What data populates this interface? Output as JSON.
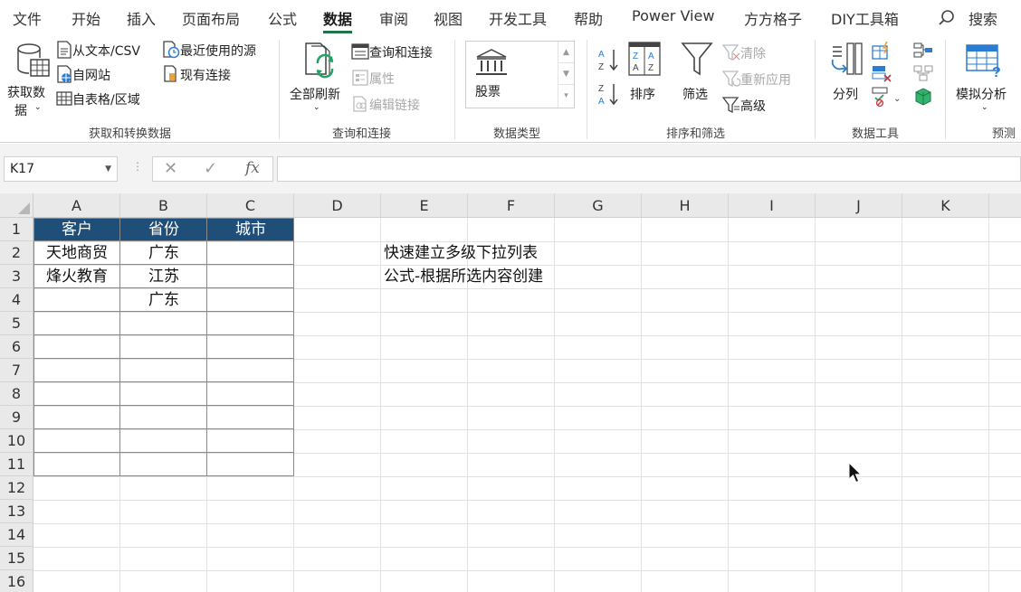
{
  "tabs": [
    {
      "label": "文件"
    },
    {
      "label": "开始"
    },
    {
      "label": "插入"
    },
    {
      "label": "页面布局"
    },
    {
      "label": "公式"
    },
    {
      "label": "数据"
    },
    {
      "label": "审阅"
    },
    {
      "label": "视图"
    },
    {
      "label": "开发工具"
    },
    {
      "label": "帮助"
    },
    {
      "label": "Power View"
    },
    {
      "label": "方方格子"
    },
    {
      "label": "DIY工具箱"
    }
  ],
  "active_tab": "数据",
  "search_label": "搜索",
  "ribbon": {
    "get_data": {
      "big_label_1": "获取数",
      "big_label_2": "据",
      "from_text": "从文本/CSV",
      "from_web": "自网站",
      "from_table": "自表格/区域",
      "recent_sources": "最近使用的源",
      "existing_connections": "现有连接",
      "group_label": "获取和转换数据"
    },
    "queries": {
      "refresh_all": "全部刷新",
      "queries_connections": "查询和连接",
      "properties": "属性",
      "edit_links": "编辑链接",
      "group_label": "查询和连接"
    },
    "data_types": {
      "stocks": "股票",
      "group_label": "数据类型"
    },
    "sort_filter": {
      "sort": "排序",
      "filter": "筛选",
      "clear": "清除",
      "reapply": "重新应用",
      "advanced": "高级",
      "group_label": "排序和筛选"
    },
    "data_tools": {
      "text_to_columns": "分列",
      "group_label": "数据工具"
    },
    "forecast": {
      "what_if": "模拟分析",
      "group_label": "预测"
    }
  },
  "formula_bar": {
    "name_box": "K17",
    "fx": "fx",
    "formula": ""
  },
  "columns": [
    "A",
    "B",
    "C",
    "D",
    "E",
    "F",
    "G",
    "H",
    "I",
    "J",
    "K"
  ],
  "rows": [
    "1",
    "2",
    "3",
    "4",
    "5",
    "6",
    "7",
    "8",
    "9",
    "10",
    "11",
    "12",
    "13",
    "14",
    "15",
    "16"
  ],
  "table": {
    "headers": [
      "客户",
      "省份",
      "城市"
    ],
    "rows": [
      [
        "天地商贸",
        "广东",
        ""
      ],
      [
        "烽火教育",
        "江苏",
        ""
      ],
      [
        "",
        "广东",
        ""
      ]
    ]
  },
  "notes": {
    "line1": "快速建立多级下拉列表",
    "line2": "公式-根据所选内容创建"
  },
  "colors": {
    "accent": "#217346",
    "header_fill": "#1f4e79",
    "header_text": "#ffffff"
  }
}
